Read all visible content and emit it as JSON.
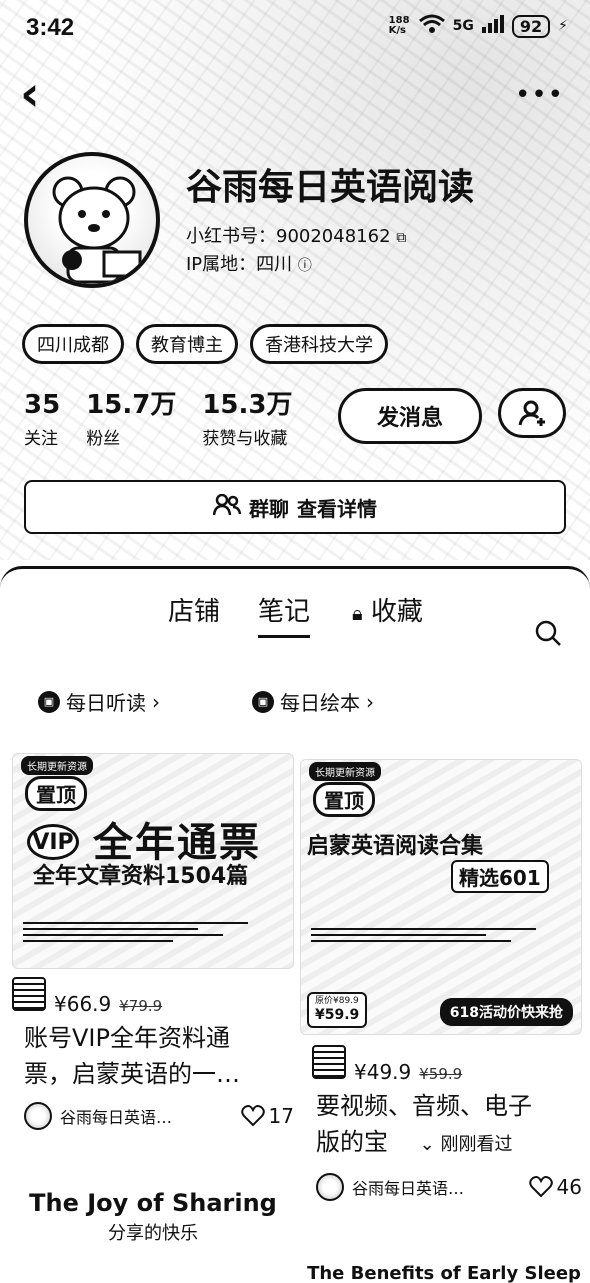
{
  "status_bar": {
    "time": "3:42",
    "network_speed": "188 K/s",
    "network_type": "5G",
    "battery": "92"
  },
  "profile": {
    "name": "谷雨每日英语阅读",
    "xhs_id": "小红书号：9002048162",
    "ip_location": "IP属地：四川",
    "tags": [
      "四川成都",
      "教育博主",
      "香港科技大学"
    ],
    "stats": [
      {
        "value": "35",
        "label": "关注"
      },
      {
        "value": "15.7万",
        "label": "粉丝"
      },
      {
        "value": "15.3万",
        "label": "获赞与收藏"
      }
    ],
    "message_button": "发消息",
    "group_chat": "群聊",
    "group_detail": "查看详情"
  },
  "tabs": {
    "shop": "店铺",
    "notes": "笔记",
    "collect": "收藏"
  },
  "sub_tabs": [
    "每日听读",
    "每日绘本"
  ],
  "cards": [
    {
      "image": {
        "chip": "长期更新资源",
        "top_badge": "置顶",
        "vip": "VIP",
        "headline": "全年通票",
        "subline": "全年文章资料1504篇"
      },
      "price": "¥66.9",
      "old_price": "¥79.9",
      "title_line1": "账号VIP全年资料通",
      "title_line2": "票，启蒙英语的一…",
      "author": "谷雨每日英语…",
      "likes": "17"
    },
    {
      "image": {
        "chip": "长期更新资源",
        "top_badge": "置顶",
        "headline": "启蒙英语阅读合集",
        "subline": "精选601",
        "price_label": "原价¥89.9",
        "price_value": "¥59.9",
        "promo": "618活动价快来抢"
      },
      "price": "¥49.9",
      "old_price": "¥59.9",
      "title_line1": "要视频、音频、电子",
      "title_line2": "版的宝",
      "seen": "刚刚看过",
      "author": "谷雨每日英语…",
      "likes": "46"
    }
  ],
  "bottom_cards": [
    {
      "title_en": "The Joy of Sharing",
      "title_zh": "分享的快乐"
    },
    {
      "title_en": "The Benefits of Early Sleep"
    }
  ]
}
